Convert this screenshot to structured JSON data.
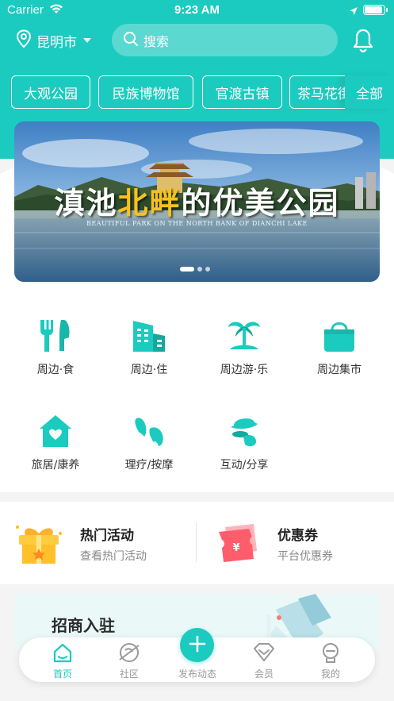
{
  "status_bar": {
    "carrier": "Carrier",
    "time": "9:23 AM"
  },
  "header": {
    "city": "昆明市",
    "search_placeholder": "搜索"
  },
  "chips": [
    "大观公园",
    "民族博物馆",
    "官渡古镇",
    "茶马花街"
  ],
  "all_label": "全部",
  "banner": {
    "title_prefix": "滇池",
    "title_highlight": "北畔",
    "title_suffix": "的优美公园",
    "subtitle": "BEAUTIFUL PARK ON THE NORTH BANK OF DIANCHI LAKE",
    "page_count": 3,
    "active_page": 1
  },
  "categories": [
    {
      "label": "周边·食",
      "icon": "fork-knife-icon"
    },
    {
      "label": "周边·住",
      "icon": "hotel-building-icon"
    },
    {
      "label": "周边游·乐",
      "icon": "palm-island-icon"
    },
    {
      "label": "周边集市",
      "icon": "shopping-bag-icon"
    },
    {
      "label": "旅居/康养",
      "icon": "house-heart-icon"
    },
    {
      "label": "理疗/按摩",
      "icon": "massage-hands-icon"
    },
    {
      "label": "互动/分享",
      "icon": "hat-share-icon"
    }
  ],
  "promos": [
    {
      "title": "热门活动",
      "subtitle": "查看热门活动",
      "icon": "gift-box-icon"
    },
    {
      "title": "优惠券",
      "subtitle": "平台优惠券",
      "icon": "coupon-ticket-icon"
    }
  ],
  "peek_card": {
    "text": "招商入驻"
  },
  "tabbar": {
    "tabs": [
      {
        "label": "首页",
        "icon": "home-icon",
        "active": true
      },
      {
        "label": "社区",
        "icon": "community-icon",
        "active": false
      },
      {
        "label": "发布动态",
        "icon": "plus-icon",
        "active": false
      },
      {
        "label": "会员",
        "icon": "diamond-icon",
        "active": false
      },
      {
        "label": "我的",
        "icon": "profile-icon",
        "active": false
      }
    ]
  },
  "colors": {
    "accent": "#1ccbbf",
    "highlight": "#f6c21b",
    "text": "#333333",
    "muted": "#999999"
  }
}
